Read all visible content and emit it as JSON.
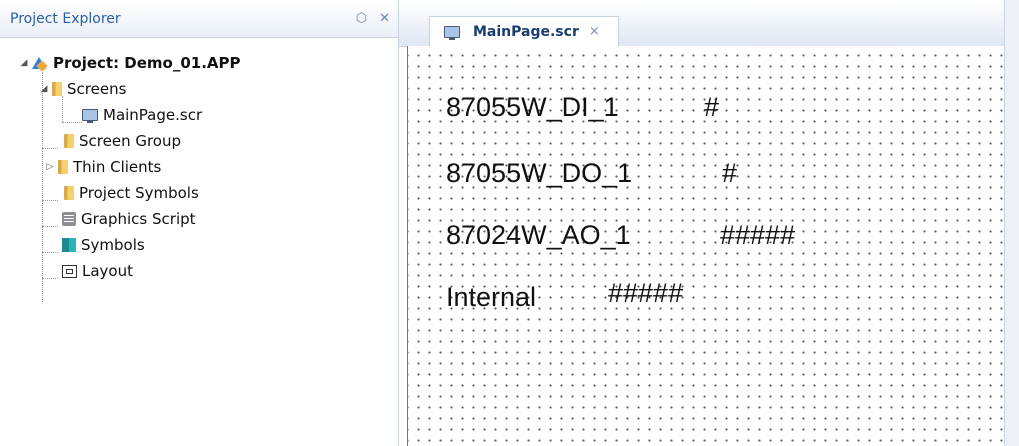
{
  "explorer": {
    "title": "Project Explorer",
    "pin_icon": "pin-icon",
    "close_icon": "close-icon",
    "items": [
      {
        "label": "Project: Demo_01.APP",
        "icon": "project-icon",
        "expanded": true
      },
      {
        "label": "Screens",
        "icon": "folder-icon",
        "expanded": true
      },
      {
        "label": "MainPage.scr",
        "icon": "screen-icon"
      },
      {
        "label": "Screen Group",
        "icon": "folder-icon"
      },
      {
        "label": "Thin Clients",
        "icon": "folder-icon",
        "expanded": false
      },
      {
        "label": "Project Symbols",
        "icon": "folder-icon"
      },
      {
        "label": "Graphics Script",
        "icon": "script-icon"
      },
      {
        "label": "Symbols",
        "icon": "symbols-icon"
      },
      {
        "label": "Layout",
        "icon": "layout-icon"
      }
    ]
  },
  "tab": {
    "label": "MainPage.scr",
    "close": "×"
  },
  "canvas": {
    "rows": [
      {
        "label": "87055W_DI_1",
        "value": "#"
      },
      {
        "label": "87055W_DO_1",
        "value": "#"
      },
      {
        "label": "87024W_AO_1",
        "value": "#####"
      },
      {
        "label": "Internal",
        "value": "#####"
      }
    ]
  }
}
